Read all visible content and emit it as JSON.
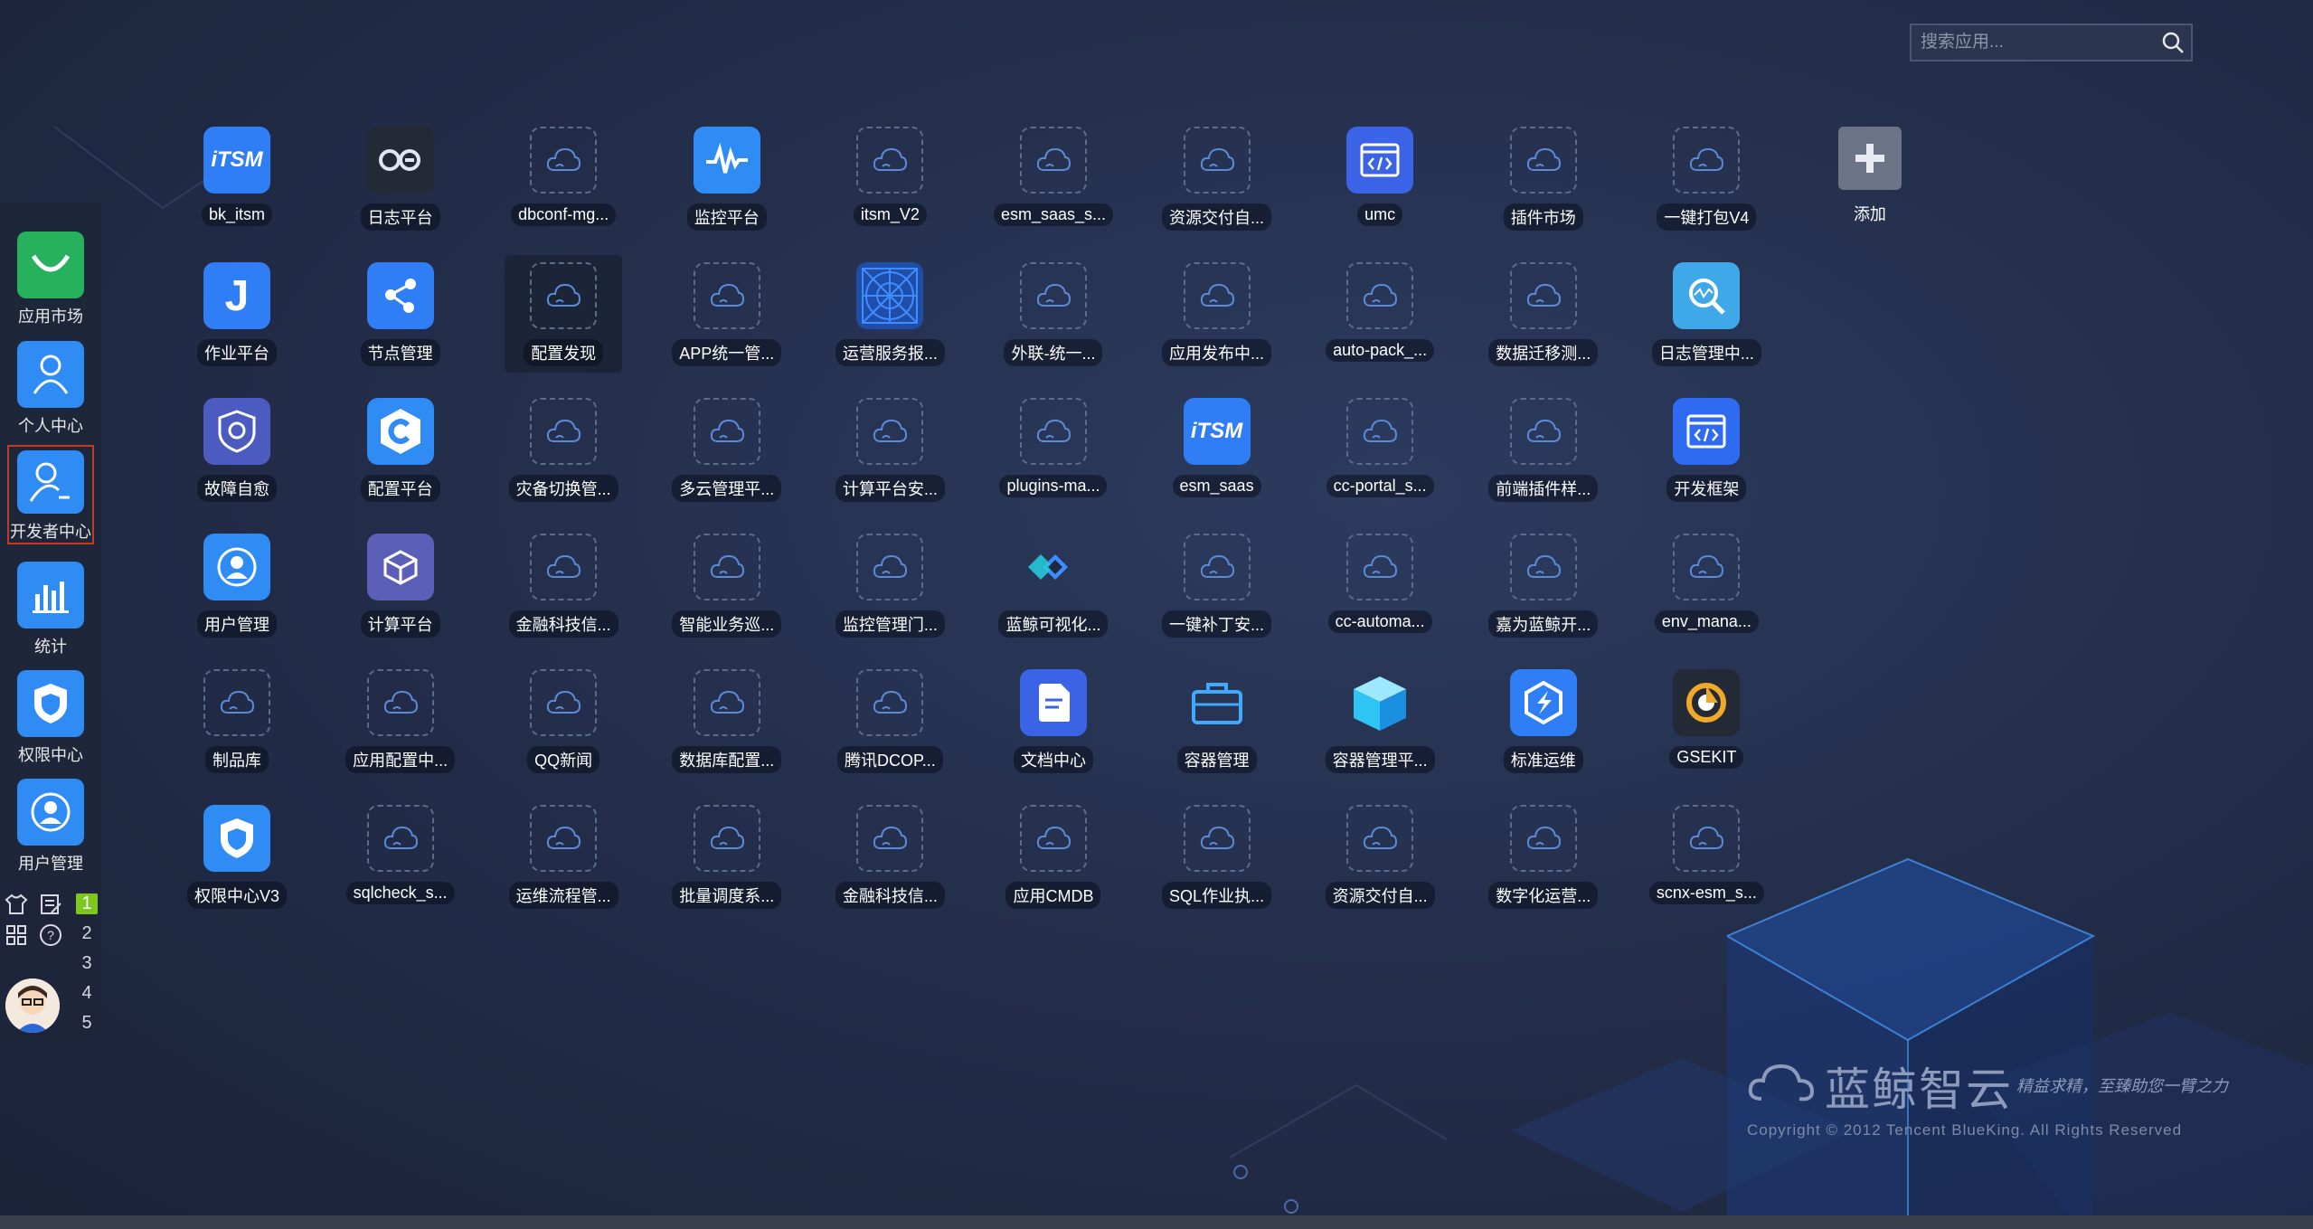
{
  "search": {
    "placeholder": "搜索应用..."
  },
  "apps": [
    {
      "label": "bk_itsm",
      "icon": "itsm-icon",
      "bg": "#2f7ef5"
    },
    {
      "label": "日志平台",
      "icon": "log-platform-icon",
      "bg": "#232a36"
    },
    {
      "label": "dbconf-mg...",
      "icon": "default-cloud-icon"
    },
    {
      "label": "监控平台",
      "icon": "monitor-icon",
      "bg": "#2f8cf5"
    },
    {
      "label": "itsm_V2",
      "icon": "default-cloud-icon"
    },
    {
      "label": "esm_saas_s...",
      "icon": "default-cloud-icon"
    },
    {
      "label": "资源交付自...",
      "icon": "default-cloud-icon"
    },
    {
      "label": "umc",
      "icon": "code-window-icon",
      "bg": "#3a63e6"
    },
    {
      "label": "插件市场",
      "icon": "default-cloud-icon"
    },
    {
      "label": "一键打包V4",
      "icon": "default-cloud-icon"
    },
    {
      "label": "添加",
      "icon": "add-icon",
      "bg": "#6b7386"
    },
    {
      "label": "作业平台",
      "icon": "job-icon",
      "bg": "#2f7ef5"
    },
    {
      "label": "节点管理",
      "icon": "node-icon",
      "bg": "#2f7ef5"
    },
    {
      "label": "配置发现",
      "icon": "default-cloud-icon",
      "active": true
    },
    {
      "label": "APP统一管...",
      "icon": "default-cloud-icon"
    },
    {
      "label": "运营服务报...",
      "icon": "radar-icon",
      "bg": "#1f4ea8"
    },
    {
      "label": "外联-统一...",
      "icon": "default-cloud-icon"
    },
    {
      "label": "应用发布中...",
      "icon": "default-cloud-icon"
    },
    {
      "label": "auto-pack_...",
      "icon": "default-cloud-icon"
    },
    {
      "label": "数据迁移测...",
      "icon": "default-cloud-icon"
    },
    {
      "label": "日志管理中...",
      "icon": "log-search-icon",
      "bg": "#3fa8e8"
    },
    null,
    {
      "label": "故障自愈",
      "icon": "fault-heal-icon",
      "bg": "#4b5bc0"
    },
    {
      "label": "配置平台",
      "icon": "cmdb-icon",
      "bg": "#2f8cf5"
    },
    {
      "label": "灾备切换管...",
      "icon": "default-cloud-icon"
    },
    {
      "label": "多云管理平...",
      "icon": "default-cloud-icon"
    },
    {
      "label": "计算平台安...",
      "icon": "default-cloud-icon"
    },
    {
      "label": "plugins-ma...",
      "icon": "default-cloud-icon"
    },
    {
      "label": "esm_saas",
      "icon": "itsm-icon",
      "bg": "#2f7ef5"
    },
    {
      "label": "cc-portal_s...",
      "icon": "default-cloud-icon"
    },
    {
      "label": "前端插件样...",
      "icon": "default-cloud-icon"
    },
    {
      "label": "开发框架",
      "icon": "code-window-icon",
      "bg": "#2f6bf0"
    },
    null,
    {
      "label": "用户管理",
      "icon": "user-manage-icon",
      "bg": "#2f8cf5"
    },
    {
      "label": "计算平台",
      "icon": "cube-icon",
      "bg": "#5b5fb8"
    },
    {
      "label": "金融科技信...",
      "icon": "default-cloud-icon"
    },
    {
      "label": "智能业务巡...",
      "icon": "default-cloud-icon"
    },
    {
      "label": "监控管理门...",
      "icon": "default-cloud-icon"
    },
    {
      "label": "蓝鲸可视化...",
      "icon": "visual-diamond-icon",
      "bg": "transparent"
    },
    {
      "label": "一键补丁安...",
      "icon": "default-cloud-icon"
    },
    {
      "label": "cc-automa...",
      "icon": "default-cloud-icon"
    },
    {
      "label": "嘉为蓝鲸开...",
      "icon": "default-cloud-icon"
    },
    {
      "label": "env_mana...",
      "icon": "default-cloud-icon"
    },
    null,
    {
      "label": "制品库",
      "icon": "default-cloud-icon"
    },
    {
      "label": "应用配置中...",
      "icon": "default-cloud-icon"
    },
    {
      "label": "QQ新闻",
      "icon": "default-cloud-icon"
    },
    {
      "label": "数据库配置...",
      "icon": "default-cloud-icon"
    },
    {
      "label": "腾讯DCOP...",
      "icon": "default-cloud-icon"
    },
    {
      "label": "文档中心",
      "icon": "document-icon",
      "bg": "#3a63e6"
    },
    {
      "label": "容器管理",
      "icon": "briefcase-icon",
      "bg": "transparent"
    },
    {
      "label": "容器管理平...",
      "icon": "box-icon",
      "bg": "transparent"
    },
    {
      "label": "标准运维",
      "icon": "standard-ops-icon",
      "bg": "#2f7ef5"
    },
    {
      "label": "GSEKIT",
      "icon": "gsekit-icon",
      "bg": "#232a36"
    },
    null,
    {
      "label": "权限中心V3",
      "icon": "shield-icon",
      "bg": "#2f8cf5"
    },
    {
      "label": "sqlcheck_s...",
      "icon": "default-cloud-icon"
    },
    {
      "label": "运维流程管...",
      "icon": "default-cloud-icon"
    },
    {
      "label": "批量调度系...",
      "icon": "default-cloud-icon"
    },
    {
      "label": "金融科技信...",
      "icon": "default-cloud-icon"
    },
    {
      "label": "应用CMDB",
      "icon": "default-cloud-icon"
    },
    {
      "label": "SQL作业执...",
      "icon": "default-cloud-icon"
    },
    {
      "label": "资源交付自...",
      "icon": "default-cloud-icon"
    },
    {
      "label": "数字化运营...",
      "icon": "default-cloud-icon"
    },
    {
      "label": "scnx-esm_s...",
      "icon": "default-cloud-icon"
    }
  ],
  "sidebar": {
    "items": [
      {
        "label": "应用市场",
        "icon": "app-market-icon",
        "bg": "#27b15d"
      },
      {
        "label": "个人中心",
        "icon": "person-icon",
        "bg": "#2f8cf5"
      },
      {
        "label": "开发者中心",
        "icon": "developer-icon",
        "bg": "#2f8cf5",
        "selected": true
      },
      {
        "label": "统计",
        "icon": "bar-chart-icon",
        "bg": "#2f8cf5"
      },
      {
        "label": "权限中心",
        "icon": "shield-icon",
        "bg": "#2f8cf5"
      },
      {
        "label": "用户管理",
        "icon": "user-manage-icon",
        "bg": "#2f8cf5"
      }
    ],
    "tools": [
      "shirt-icon",
      "note-icon",
      "grid-icon",
      "help-icon"
    ],
    "pages": [
      "1",
      "2",
      "3",
      "4",
      "5"
    ],
    "current_page": "1"
  },
  "brand": {
    "name": "蓝鲸智云",
    "slogan": "精益求精，至臻助您一臂之力",
    "copyright": "Copyright © 2012 Tencent BlueKing. All Rights Reserved"
  }
}
